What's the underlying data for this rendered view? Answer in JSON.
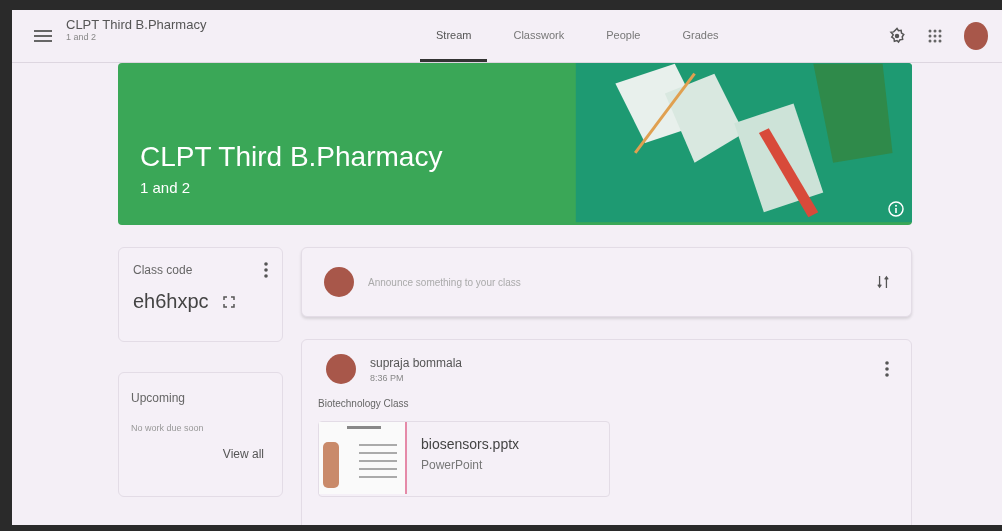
{
  "header": {
    "title": "CLPT Third B.Pharmacy",
    "subtitle": "1 and 2"
  },
  "tabs": [
    {
      "label": "Stream",
      "selected": true
    },
    {
      "label": "Classwork",
      "selected": false
    },
    {
      "label": "People",
      "selected": false
    },
    {
      "label": "Grades",
      "selected": false
    }
  ],
  "banner": {
    "title": "CLPT Third B.Pharmacy",
    "subtitle": "1 and 2"
  },
  "class_code": {
    "label": "Class code",
    "code": "eh6hxpc"
  },
  "upcoming": {
    "title": "Upcoming",
    "message": "No work due soon",
    "link": "View all"
  },
  "announce": {
    "placeholder": "Announce something to your class"
  },
  "posts": [
    {
      "author": "supraja bommala",
      "time": "8:36 PM",
      "text": "Biotechnology Class",
      "attachment": {
        "name": "biosensors.pptx",
        "type": "PowerPoint"
      }
    }
  ]
}
